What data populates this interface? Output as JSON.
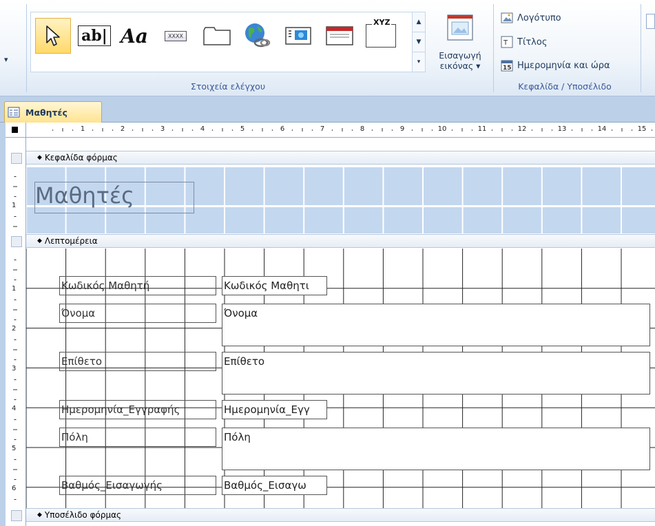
{
  "ribbon": {
    "left_arrow": "▾",
    "controls_group_label": "Στοιχεία ελέγχου",
    "gallery_items": [
      {
        "name": "select-pointer-icon",
        "text": ""
      },
      {
        "name": "textbox-icon",
        "text": "ab|"
      },
      {
        "name": "label-icon",
        "text": "Aa"
      },
      {
        "name": "button-icon",
        "text": "XXXX"
      },
      {
        "name": "tab-control-icon",
        "text": ""
      },
      {
        "name": "hyperlink-icon",
        "text": ""
      },
      {
        "name": "web-browser-icon",
        "text": ""
      },
      {
        "name": "navigation-control-icon",
        "text": ""
      },
      {
        "name": "option-group-icon",
        "text": "XYZ"
      }
    ],
    "insert_image": {
      "line1": "Εισαγωγή",
      "line2": "εικόνας ▾"
    },
    "header_footer": {
      "logo": "Λογότυπο",
      "title": "Τίτλος",
      "date_time": "Ημερομηνία και ώρα",
      "group_label": "Κεφαλίδα / Υποσέλιδο"
    }
  },
  "document_tab": {
    "label": "Μαθητές"
  },
  "ruler": {
    "marks": [
      "1",
      "2",
      "3",
      "4",
      "5",
      "6",
      "7",
      "8",
      "9",
      "10",
      "11",
      "12",
      "13",
      "14",
      "15"
    ]
  },
  "vertical_ruler": {
    "header_marks": [
      "1"
    ],
    "detail_marks": [
      "1",
      "2",
      "3",
      "4",
      "5",
      "6"
    ]
  },
  "sections": {
    "header": "Κεφαλίδα φόρμας",
    "detail": "Λεπτομέρεια",
    "footer": "Υποσέλιδο φόρμας"
  },
  "form_title": "Μαθητές",
  "fields": [
    {
      "label": "Κωδικός Μαθητή",
      "control": "Κωδικός Μαθητι"
    },
    {
      "label": "Όνομα",
      "control": "Όνομα"
    },
    {
      "label": "Επίθετο",
      "control": "Επίθετο"
    },
    {
      "label": "Ημερομηνία_Εγγραφής",
      "control": "Ημερομηνία_Εγγ"
    },
    {
      "label": "Πόλη",
      "control": "Πόλη"
    },
    {
      "label": "Βαθμός_Εισαγωγής",
      "control": "Βαθμός_Εισαγω"
    }
  ]
}
